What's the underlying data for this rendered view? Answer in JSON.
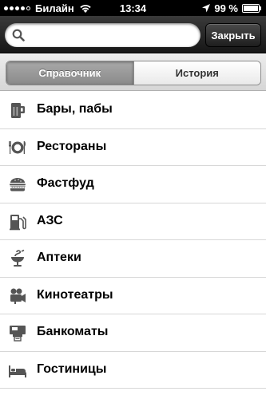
{
  "status_bar": {
    "carrier": "Билайн",
    "time": "13:34",
    "battery": "99 %",
    "battery_level": 0.99
  },
  "search": {
    "placeholder": "",
    "value": "",
    "close_label": "Закрыть"
  },
  "tabs": [
    {
      "label": "Справочник",
      "selected": true
    },
    {
      "label": "История",
      "selected": false
    }
  ],
  "categories": [
    {
      "label": "Бары, пабы",
      "icon": "beer-mug-icon"
    },
    {
      "label": "Рестораны",
      "icon": "plate-cutlery-icon"
    },
    {
      "label": "Фастфуд",
      "icon": "burger-icon"
    },
    {
      "label": "АЗС",
      "icon": "gas-pump-icon"
    },
    {
      "label": "Аптеки",
      "icon": "pharmacy-bowl-icon"
    },
    {
      "label": "Кинотеатры",
      "icon": "movie-camera-icon"
    },
    {
      "label": "Банкоматы",
      "icon": "atm-icon"
    },
    {
      "label": "Гостиницы",
      "icon": "bed-icon"
    }
  ]
}
